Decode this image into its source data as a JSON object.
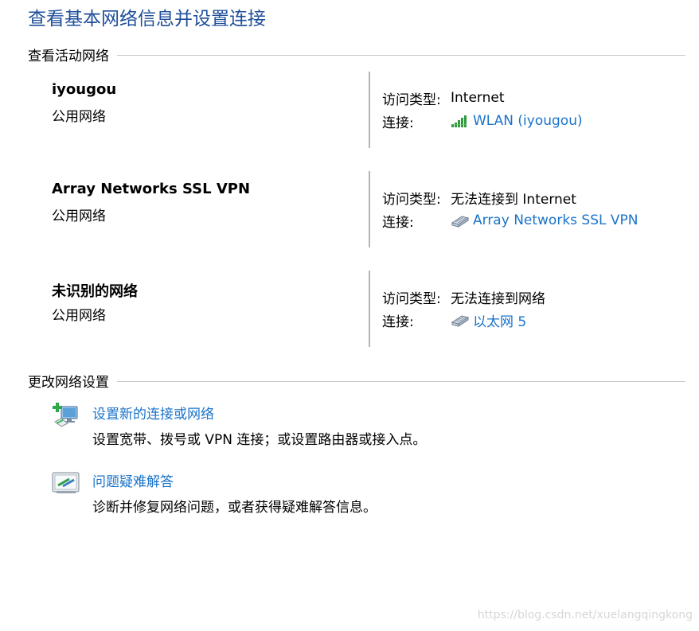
{
  "page_title": "查看基本网络信息并设置连接",
  "active_networks_header": "查看活动网络",
  "networks": [
    {
      "name": "iyougou",
      "category": "公用网络",
      "access_type_label": "访问类型:",
      "access_type_value": "Internet",
      "connection_label": "连接:",
      "connection_value": "WLAN (iyougou)",
      "connection_icon": "wifi-signal-icon"
    },
    {
      "name": "Array Networks SSL VPN",
      "category": "公用网络",
      "access_type_label": "访问类型:",
      "access_type_value": "无法连接到 Internet",
      "connection_label": "连接:",
      "connection_value": "Array Networks SSL VPN",
      "connection_icon": "ethernet-icon"
    },
    {
      "name": "未识别的网络",
      "category": "公用网络",
      "access_type_label": "访问类型:",
      "access_type_value": "无法连接到网络",
      "connection_label": "连接:",
      "connection_value": "以太网 5",
      "connection_icon": "ethernet-icon"
    }
  ],
  "change_settings_header": "更改网络设置",
  "tasks": [
    {
      "link": "设置新的连接或网络",
      "description": "设置宽带、拨号或 VPN 连接；或设置路由器或接入点。",
      "icon": "new-connection-icon"
    },
    {
      "link": "问题疑难解答",
      "description": "诊断并修复网络问题，或者获得疑难解答信息。",
      "icon": "troubleshoot-icon"
    }
  ],
  "watermark": "https://blog.csdn.net/xuelangqingkong",
  "colors": {
    "title": "#1e4e9a",
    "link": "#1a73c9",
    "divider": "#b5b5b5",
    "rule": "#c8c8c8"
  }
}
